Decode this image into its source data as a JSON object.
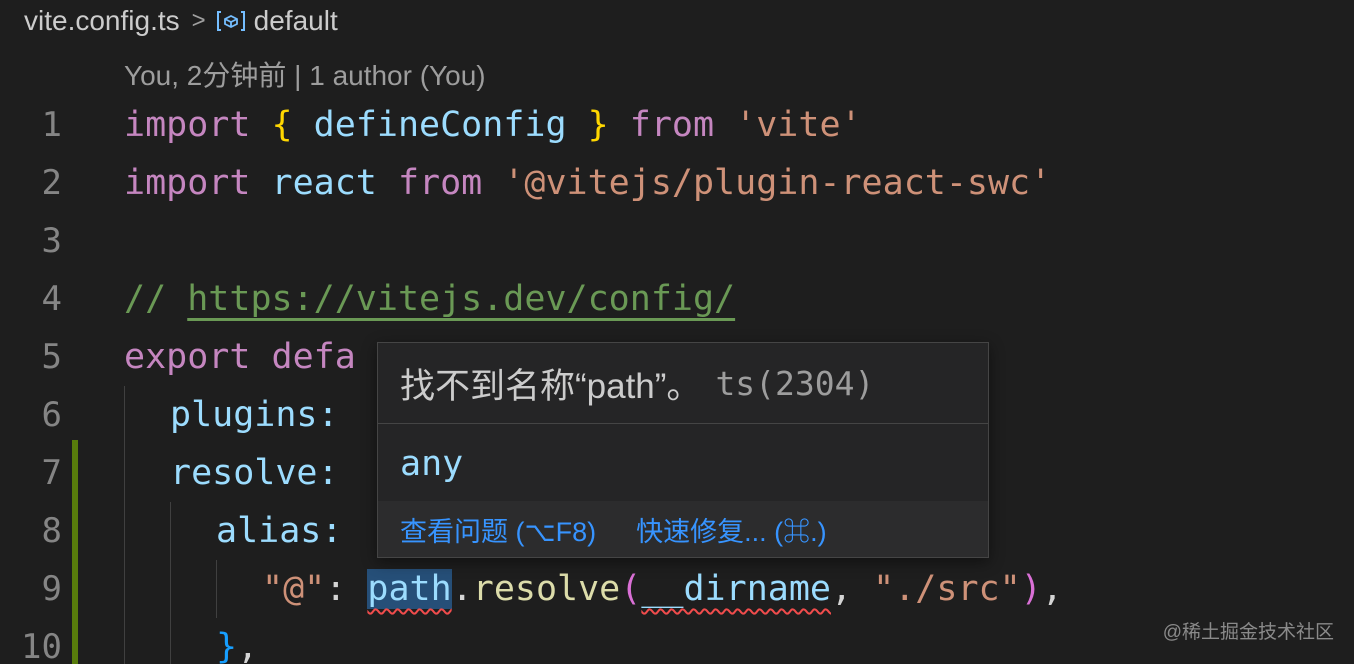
{
  "breadcrumb": {
    "file": "vite.config.ts",
    "separator": ">",
    "symbol_icon": "symbol-variable-icon",
    "symbol": "default"
  },
  "blame": "You, 2分钟前 | 1 author (You)",
  "lines": {
    "n1": "1",
    "n2": "2",
    "n3": "3",
    "n4": "4",
    "n5": "5",
    "n6": "6",
    "n7": "7",
    "n8": "8",
    "n9": "9",
    "n10": "10"
  },
  "code": {
    "l1": {
      "import": "import",
      "ob": "{",
      "defineConfig": "defineConfig",
      "cb": "}",
      "from": "from",
      "mod": "'vite'"
    },
    "l2": {
      "import": "import",
      "react": "react",
      "from": "from",
      "mod": "'@vitejs/plugin-react-swc'"
    },
    "l4": {
      "slashes": "//",
      "url": "https://vitejs.dev/config/"
    },
    "l5": {
      "export": "export",
      "partial": "defa"
    },
    "l6": {
      "key": "plugins:"
    },
    "l7": {
      "key": "resolve:"
    },
    "l8": {
      "key": "alias:"
    },
    "l9": {
      "key": "\"@\"",
      "colon": ":",
      "path": "path",
      "dot": ".",
      "resolve": "resolve",
      "op": "(",
      "dirname": "__dirname",
      "comma": ",",
      "src": "\"./src\"",
      "cp": ")",
      "trail": ","
    },
    "l10": {
      "close": "}",
      "trail": ","
    }
  },
  "hover": {
    "message": "找不到名称“path”。",
    "code": "ts(2304)",
    "type": "any",
    "view_problem": "查看问题 (⌥F8)",
    "quick_fix": "快速修复... (⌘.)"
  },
  "watermark": "@稀土掘金技术社区",
  "colors": {
    "background": "#1e1e1e",
    "keyword": "#c586c0",
    "identifier": "#9cdcfe",
    "function": "#dcdcaa",
    "string": "#ce9178",
    "comment": "#6a9955",
    "error_squiggle": "#f14c4c",
    "link": "#3794ff",
    "gutter_modified": "#587c0c"
  }
}
